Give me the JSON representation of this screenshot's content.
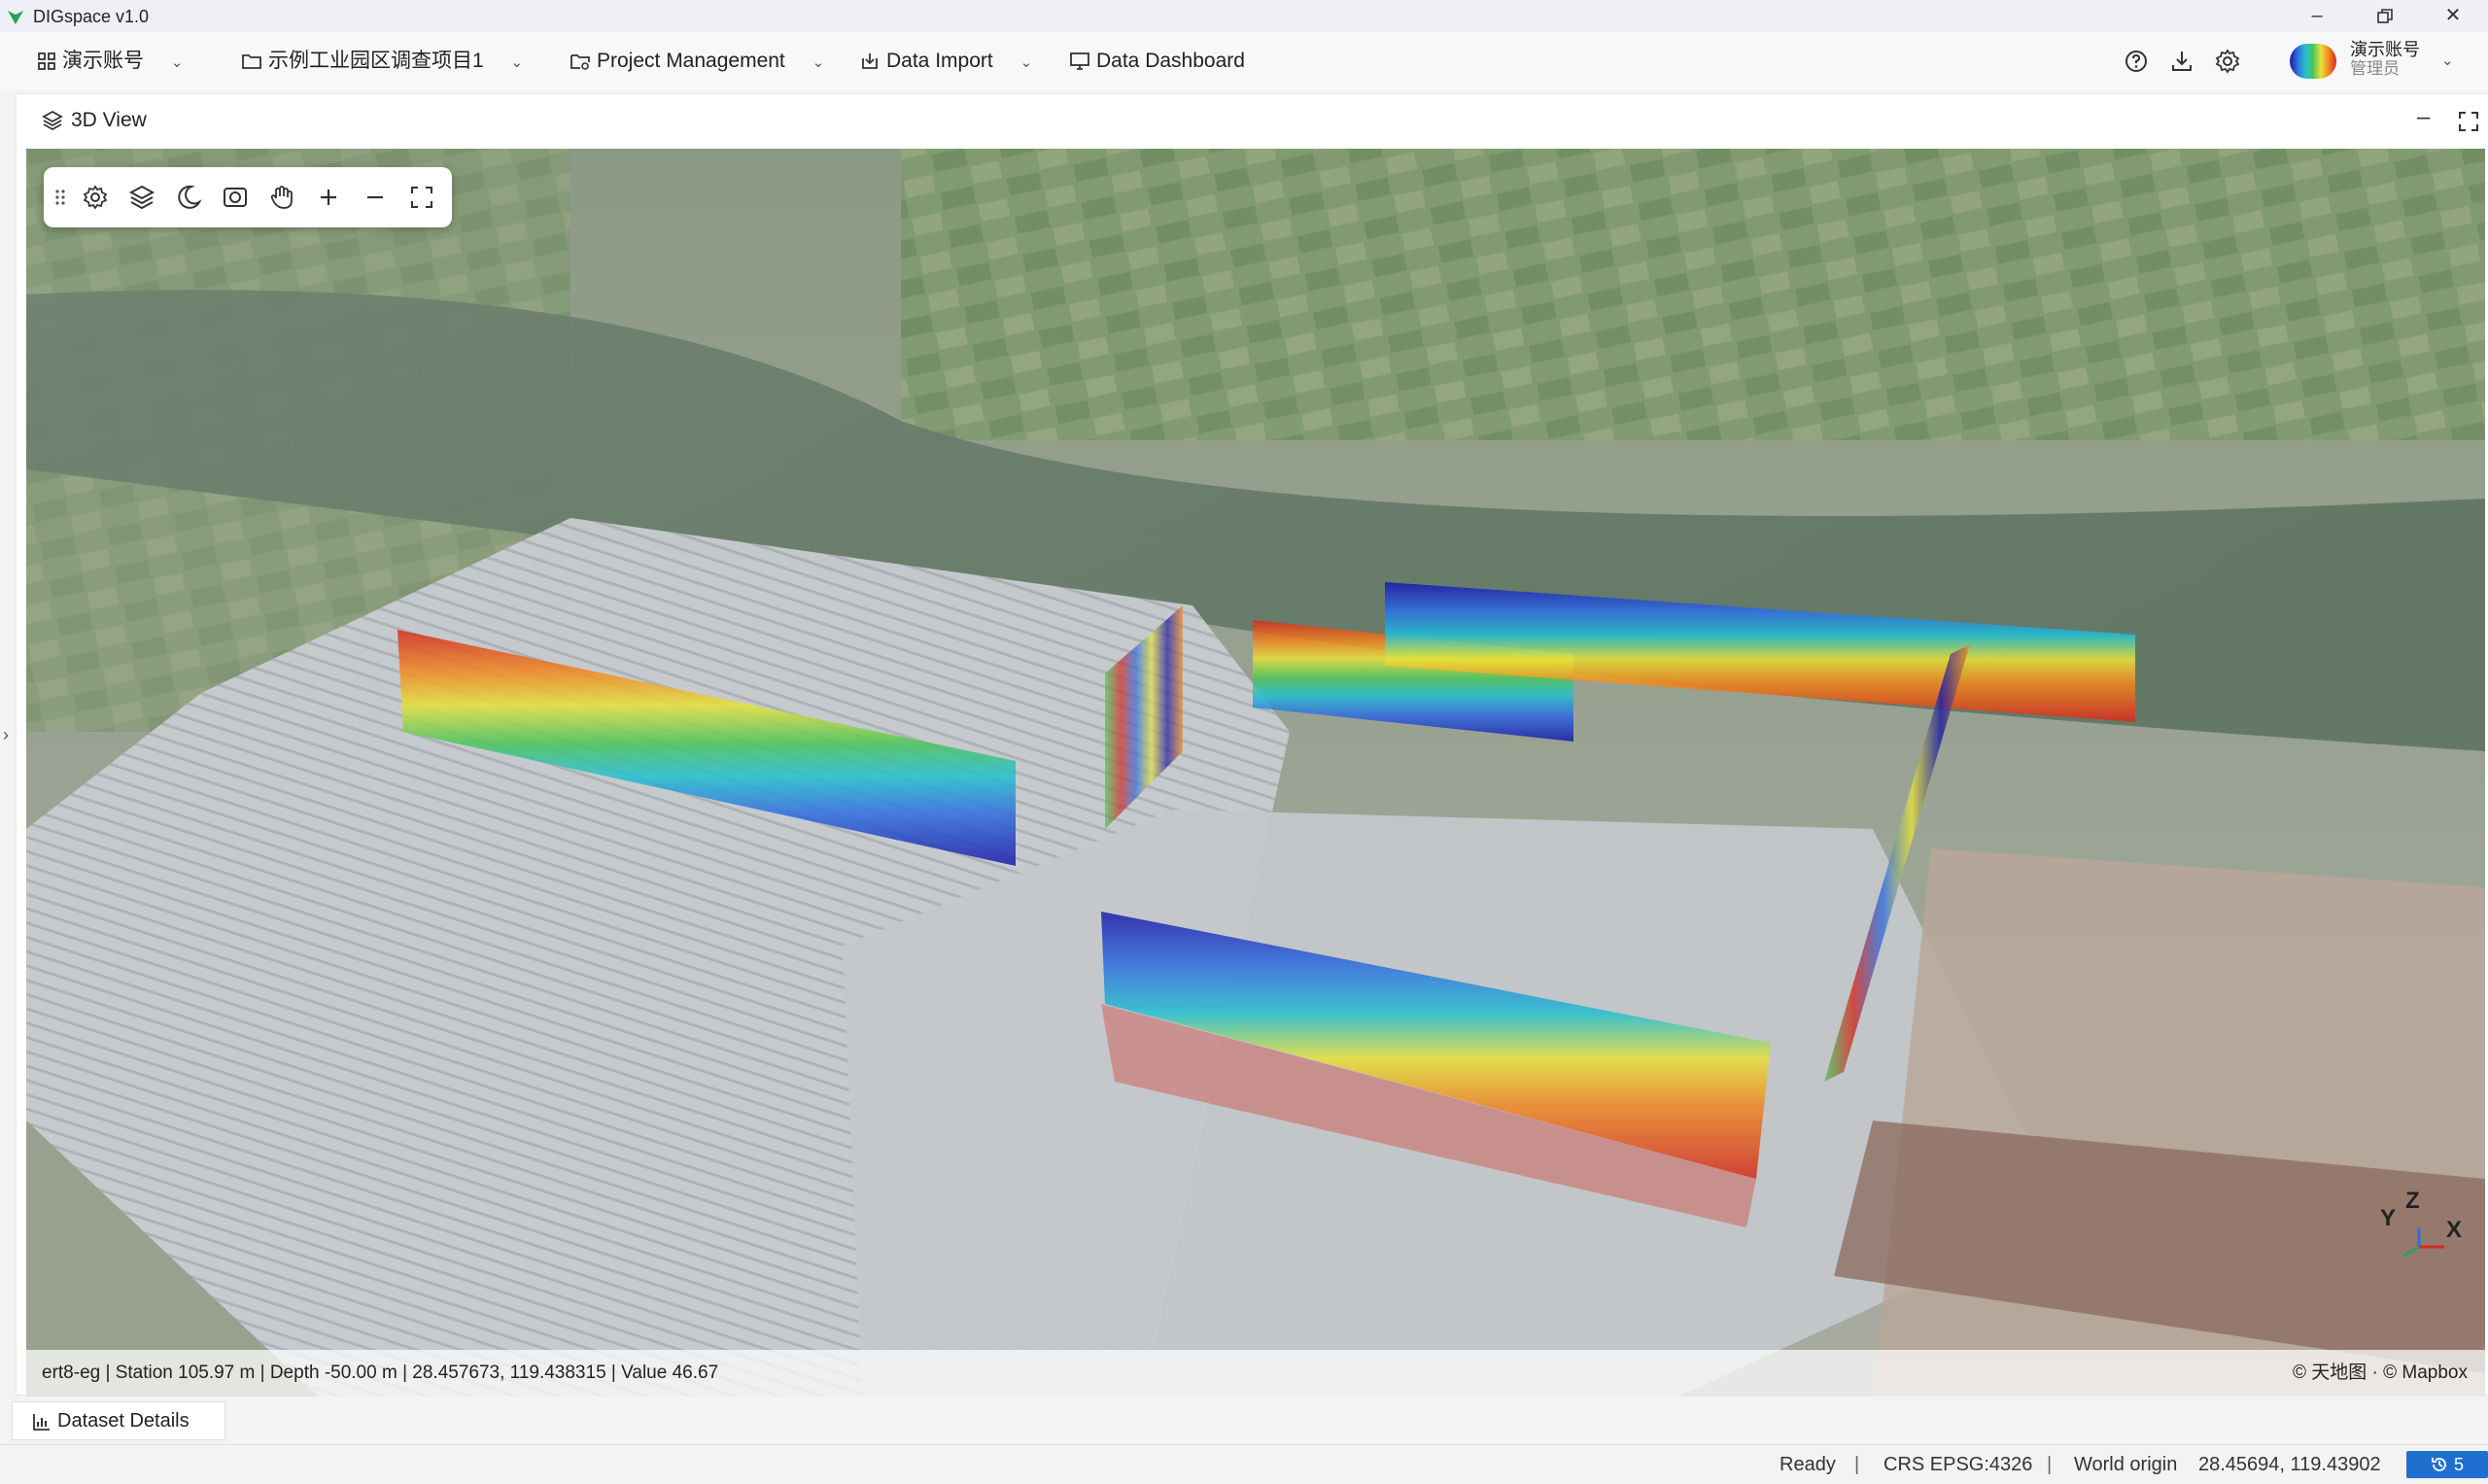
{
  "app": {
    "title": "DIGspace v1.0"
  },
  "menu": {
    "account": "演示账号",
    "project": "示例工业园区调查项目1",
    "project_management": "Project Management",
    "data_import": "Data Import",
    "data_dashboard": "Data Dashboard"
  },
  "user": {
    "name": "演示账号",
    "role": "管理员"
  },
  "view": {
    "title": "3D View",
    "status_line": "ert8-eg | Station 105.97 m | Depth -50.00 m | 28.457673, 119.438315 | Value 46.67",
    "attribution": "© 天地图 · © Mapbox",
    "axes": {
      "x": "X",
      "y": "Y",
      "z": "Z"
    }
  },
  "bottom": {
    "dataset_details": "Dataset Details"
  },
  "statusbar": {
    "ready": "Ready",
    "crs": "CRS EPSG:4326",
    "world_origin_label": "World origin",
    "world_origin_value": "28.45694, 119.43902",
    "notifications": "5"
  },
  "colors": {
    "accent": "#1f6fd1",
    "colormap": [
      "#1a1aa8",
      "#2f6de0",
      "#23c0d0",
      "#4cc45a",
      "#e6e23a",
      "#f08a20",
      "#d42a20"
    ]
  }
}
